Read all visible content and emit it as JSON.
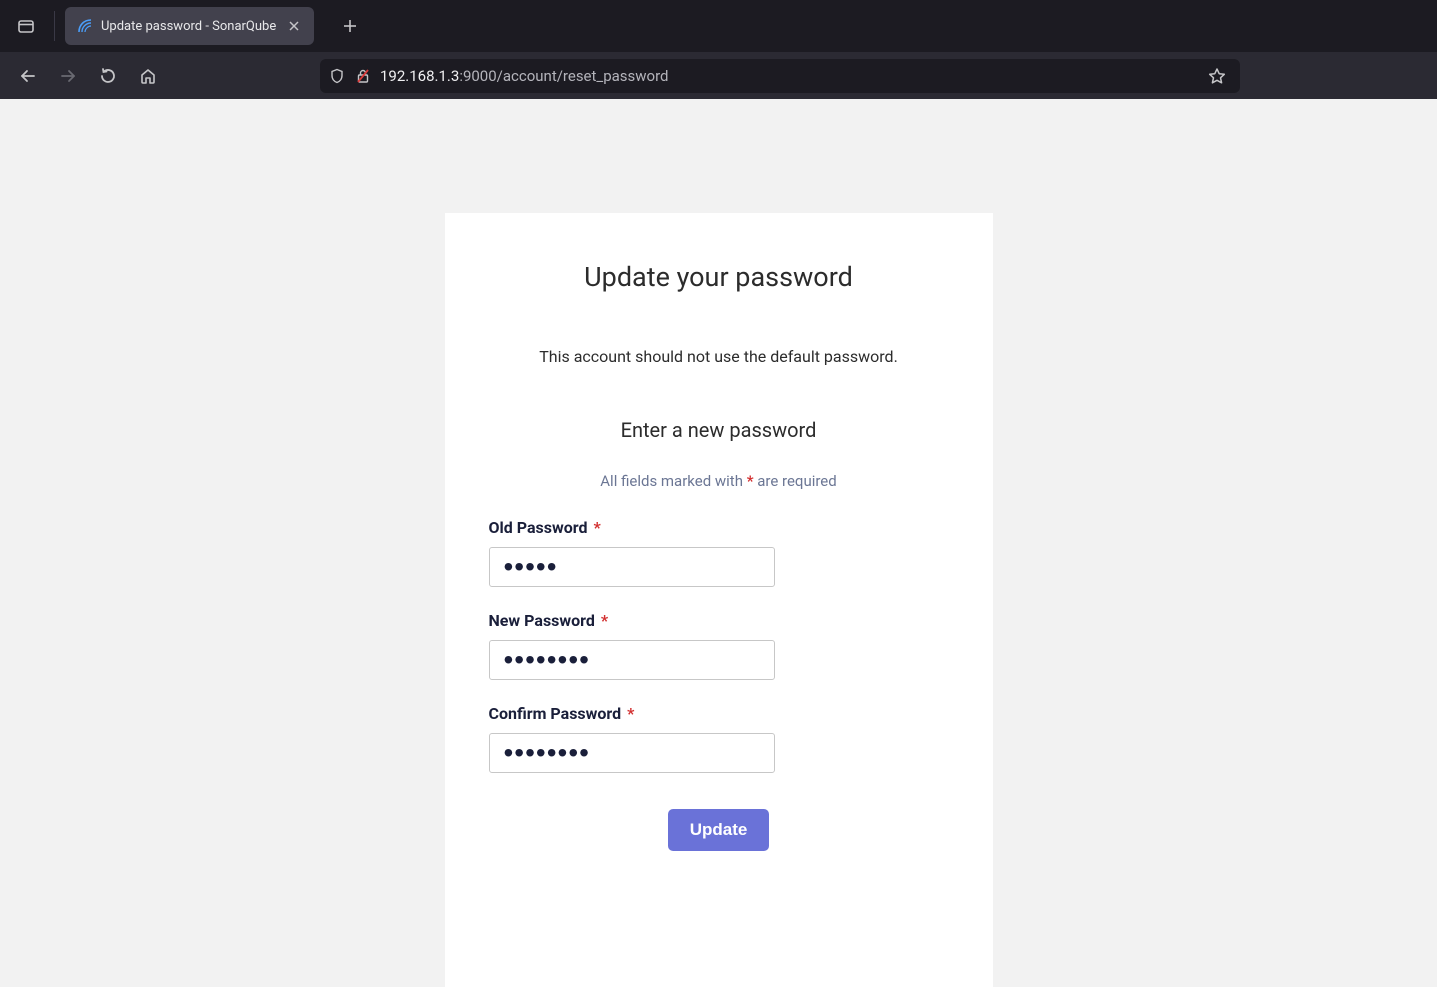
{
  "browser": {
    "tab_title": "Update password - SonarQube",
    "url_host": "192.168.1.3",
    "url_path": ":9000/account/reset_password"
  },
  "page": {
    "heading": "Update your password",
    "notice": "This account should not use the default password.",
    "subheading": "Enter a new password",
    "required_note_prefix": "All fields marked with ",
    "required_note_star": "*",
    "required_note_suffix": " are required",
    "fields": {
      "old_password": {
        "label": "Old Password",
        "value": "admin"
      },
      "new_password": {
        "label": "New Password",
        "value": "12345678"
      },
      "confirm_password": {
        "label": "Confirm Password",
        "value": "12345678"
      }
    },
    "update_button": "Update"
  }
}
